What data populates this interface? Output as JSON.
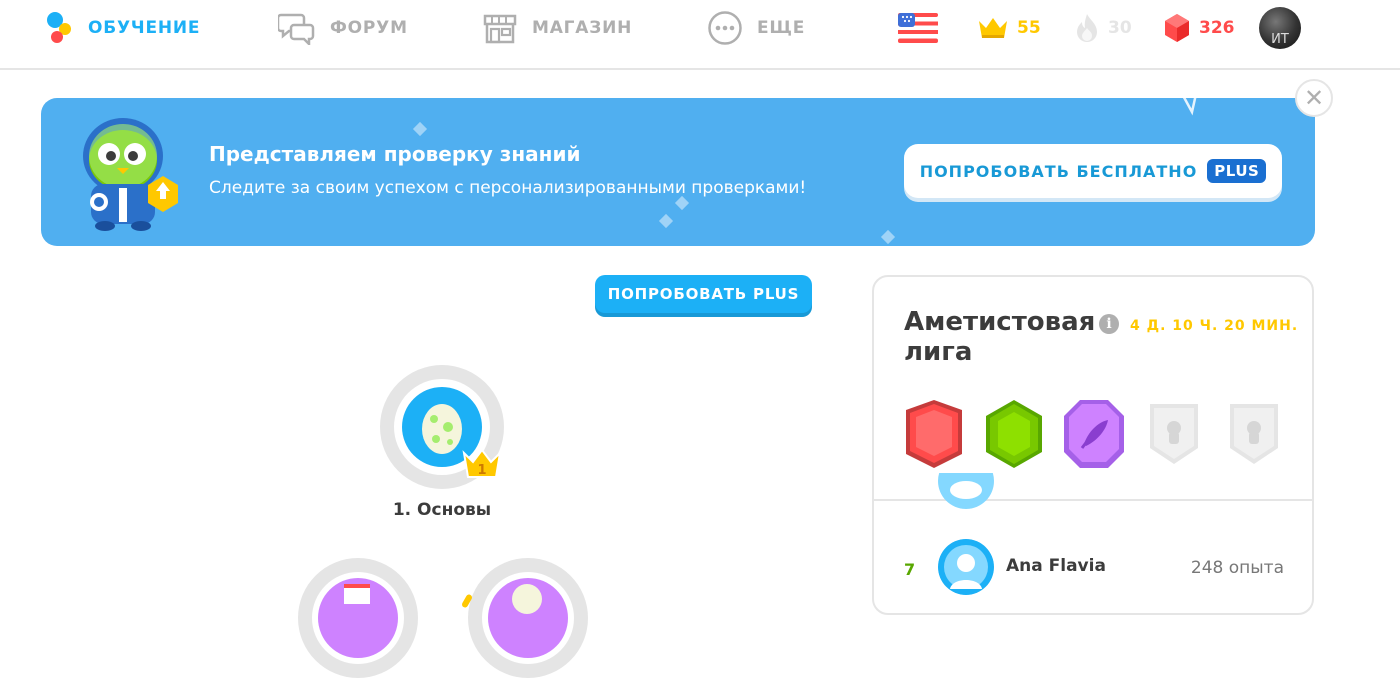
{
  "nav": {
    "learn": "ОБУЧЕНИЕ",
    "forum": "ФОРУМ",
    "shop": "МАГАЗИН",
    "more": "ЕЩЕ"
  },
  "stats": {
    "language_flag": "us-flag-icon",
    "crowns": "55",
    "streak": "30",
    "gems": "326",
    "avatar_initials": "ИТ"
  },
  "banner": {
    "title": "Представляем проверку знаний",
    "subtitle": "Следите за своим успехом с персонализированными проверками!",
    "cta": "ПОПРОБОВАТЬ БЕСПЛАТНО",
    "badge": "PLUS"
  },
  "main": {
    "try_plus": "ПОПРОБОВАТЬ PLUS",
    "skills": [
      {
        "label": "1. Основы",
        "crown_level": "1"
      }
    ]
  },
  "league": {
    "title": "Аметистовая лига",
    "timer": "4 Д. 10 Ч. 20 МИН.",
    "leaderboard": [
      {
        "rank": "7",
        "name": "Ana Flavia",
        "xp": "248 опыта"
      }
    ]
  },
  "colors": {
    "accent_blue": "#1cb0f6",
    "banner_blue": "#50aff0",
    "crown_gold": "#ffc800",
    "gem_red": "#ff4b4b",
    "league_amethyst": "#ce82ff",
    "rank_green": "#58a700"
  }
}
